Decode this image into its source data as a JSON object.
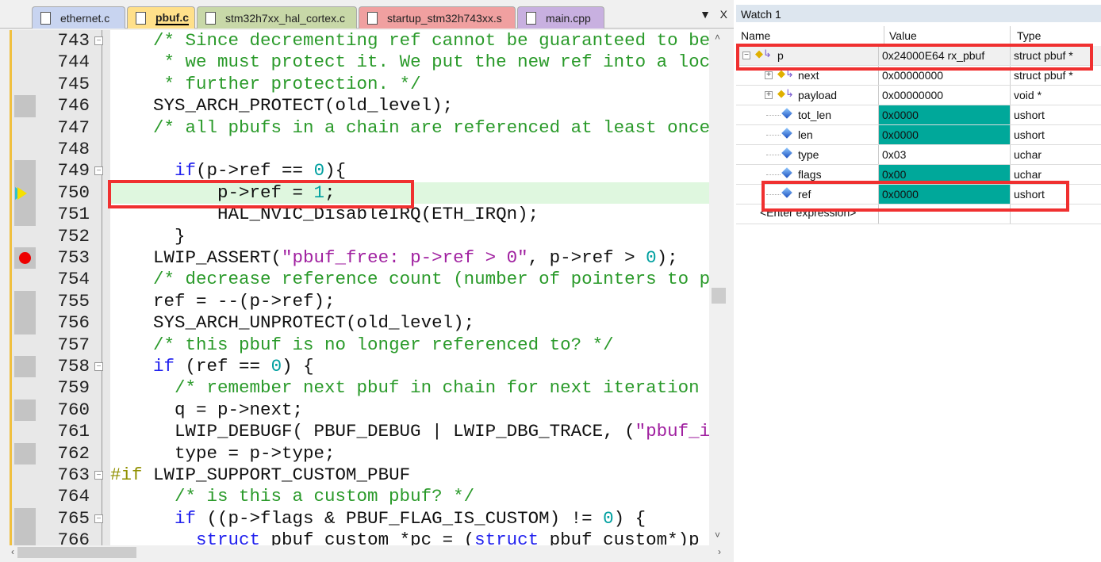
{
  "tabs": [
    {
      "label": "ethernet.c",
      "color": "#c8d4f0"
    },
    {
      "label": "pbuf.c",
      "color": "#ffe08a",
      "active": true
    },
    {
      "label": "stm32h7xx_hal_cortex.c",
      "color": "#c8d8a8"
    },
    {
      "label": "startup_stm32h743xx.s",
      "color": "#f0a0a0"
    },
    {
      "label": "main.cpp",
      "color": "#c8b0e0"
    }
  ],
  "tab_controls": {
    "dropdown": "▼",
    "close": "X"
  },
  "code": {
    "current_line": 750,
    "breakpoint_line": 753,
    "lines": [
      {
        "n": "743",
        "fold": "-",
        "t": [
          [
            "    ",
            ""
          ],
          [
            "/* Since decrementing ref cannot be guaranteed to be",
            "c"
          ]
        ]
      },
      {
        "n": "744",
        "t": [
          [
            "     ",
            ""
          ],
          [
            "* we must protect it. We put the new ref into a loc",
            "c"
          ]
        ]
      },
      {
        "n": "745",
        "t": [
          [
            "     ",
            ""
          ],
          [
            "* further protection. */",
            "c"
          ]
        ]
      },
      {
        "n": "746",
        "g": 1,
        "t": [
          [
            "    SYS_ARCH_PROTECT(old_level);",
            ""
          ]
        ]
      },
      {
        "n": "747",
        "t": [
          [
            "    ",
            ""
          ],
          [
            "/* all pbufs in a chain are referenced at least once",
            "c"
          ]
        ]
      },
      {
        "n": "748",
        "t": []
      },
      {
        "n": "749",
        "g": 1,
        "fold": "-",
        "t": [
          [
            "      ",
            ""
          ],
          [
            "if",
            "k"
          ],
          [
            "(p->ref == ",
            ""
          ],
          [
            "0",
            "n"
          ],
          [
            "){",
            ""
          ]
        ]
      },
      {
        "n": "750",
        "g": 1,
        "t": [
          [
            "          p->ref = ",
            ""
          ],
          [
            "1",
            "n"
          ],
          [
            ";",
            ""
          ]
        ]
      },
      {
        "n": "751",
        "g": 1,
        "t": [
          [
            "          HAL_NVIC_DisableIRQ(ETH_IRQn);",
            ""
          ]
        ]
      },
      {
        "n": "752",
        "t": [
          [
            "      }",
            ""
          ]
        ]
      },
      {
        "n": "753",
        "g": 1,
        "t": [
          [
            "    LWIP_ASSERT(",
            ""
          ],
          [
            "\"pbuf_free: p->ref > 0\"",
            "s"
          ],
          [
            ", p->ref > ",
            ""
          ],
          [
            "0",
            "n"
          ],
          [
            ");",
            ""
          ]
        ]
      },
      {
        "n": "754",
        "t": [
          [
            "    ",
            ""
          ],
          [
            "/* decrease reference count (number of pointers to p",
            "c"
          ]
        ]
      },
      {
        "n": "755",
        "g": 1,
        "t": [
          [
            "    ref = --(p->ref);",
            ""
          ]
        ]
      },
      {
        "n": "756",
        "g": 1,
        "t": [
          [
            "    SYS_ARCH_UNPROTECT(old_level);",
            ""
          ]
        ]
      },
      {
        "n": "757",
        "t": [
          [
            "    ",
            ""
          ],
          [
            "/* this pbuf is no longer referenced to? */",
            "c"
          ]
        ]
      },
      {
        "n": "758",
        "g": 1,
        "fold": "-",
        "t": [
          [
            "    ",
            ""
          ],
          [
            "if",
            "k"
          ],
          [
            " (ref == ",
            ""
          ],
          [
            "0",
            "n"
          ],
          [
            ") {",
            ""
          ]
        ]
      },
      {
        "n": "759",
        "t": [
          [
            "      ",
            ""
          ],
          [
            "/* remember next pbuf in chain for next iteration",
            "c"
          ]
        ]
      },
      {
        "n": "760",
        "g": 1,
        "t": [
          [
            "      q = p->next;",
            ""
          ]
        ]
      },
      {
        "n": "761",
        "t": [
          [
            "      LWIP_DEBUGF( PBUF_DEBUG | LWIP_DBG_TRACE, (",
            ""
          ],
          [
            "\"pbuf_i",
            "s"
          ]
        ]
      },
      {
        "n": "762",
        "g": 1,
        "t": [
          [
            "      type = p->type;",
            ""
          ]
        ]
      },
      {
        "n": "763",
        "fold": "-",
        "t": [
          [
            "#if",
            "p"
          ],
          [
            " LWIP_SUPPORT_CUSTOM_PBUF",
            ""
          ]
        ]
      },
      {
        "n": "764",
        "t": [
          [
            "      ",
            ""
          ],
          [
            "/* is this a custom pbuf? */",
            "c"
          ]
        ]
      },
      {
        "n": "765",
        "g": 1,
        "fold": "-",
        "t": [
          [
            "      ",
            ""
          ],
          [
            "if",
            "k"
          ],
          [
            " ((p->flags & PBUF_FLAG_IS_CUSTOM) != ",
            ""
          ],
          [
            "0",
            "n"
          ],
          [
            ") {",
            ""
          ]
        ]
      },
      {
        "n": "766",
        "g": 1,
        "t": [
          [
            "        ",
            ""
          ],
          [
            "struct",
            "k"
          ],
          [
            " pbuf_custom *pc = (",
            ""
          ],
          [
            "struct",
            "k"
          ],
          [
            " pbuf_custom*)p",
            ""
          ]
        ]
      }
    ]
  },
  "watch": {
    "title": "Watch 1",
    "headers": {
      "name": "Name",
      "value": "Value",
      "type": "Type"
    },
    "rows": [
      {
        "name": "p",
        "value": "0x24000E64 rx_pbuf",
        "type": "struct pbuf *",
        "level": 0,
        "expand": "-",
        "icon": "struct",
        "changed": false
      },
      {
        "name": "next",
        "value": "0x00000000",
        "type": "struct pbuf *",
        "level": 1,
        "expand": "+",
        "icon": "struct",
        "changed": false
      },
      {
        "name": "payload",
        "value": "0x00000000",
        "type": "void *",
        "level": 1,
        "expand": "+",
        "icon": "struct",
        "changed": false
      },
      {
        "name": "tot_len",
        "value": "0x0000",
        "type": "ushort",
        "level": 1,
        "icon": "var",
        "changed": true
      },
      {
        "name": "len",
        "value": "0x0000",
        "type": "ushort",
        "level": 1,
        "icon": "var",
        "changed": true
      },
      {
        "name": "type",
        "value": "0x03",
        "type": "uchar",
        "level": 1,
        "icon": "var",
        "changed": false
      },
      {
        "name": "flags",
        "value": "0x00",
        "type": "uchar",
        "level": 1,
        "icon": "var",
        "changed": true
      },
      {
        "name": "ref",
        "value": "0x0000",
        "type": "ushort",
        "level": 1,
        "icon": "var",
        "changed": true
      }
    ],
    "enter_expression": "<Enter expression>",
    "changed_color": "#00a89a"
  },
  "highlight_color": "#f03030"
}
